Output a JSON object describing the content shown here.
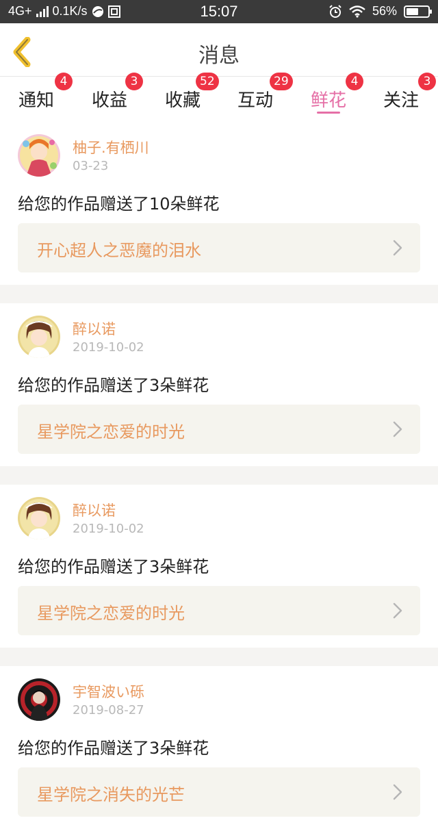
{
  "status_bar": {
    "network": "4G+",
    "speed": "0.1K/s",
    "time": "15:07",
    "battery_percent": "56%",
    "battery_level": 0.56,
    "icons": [
      "signal-icon",
      "browser-icon",
      "app-icon",
      "alarm-icon",
      "wifi-icon",
      "battery-icon"
    ]
  },
  "header": {
    "back_icon": "chevron-left-icon",
    "title": "消息"
  },
  "tabs": [
    {
      "label": "通知",
      "badge": "4",
      "active": false
    },
    {
      "label": "收益",
      "badge": "3",
      "active": false
    },
    {
      "label": "收藏",
      "badge": "52",
      "active": false
    },
    {
      "label": "互动",
      "badge": "29",
      "active": false
    },
    {
      "label": "鲜花",
      "badge": "4",
      "active": true
    },
    {
      "label": "关注",
      "badge": "3",
      "active": false
    }
  ],
  "colors": {
    "accent": "#e56fa6",
    "name_orange": "#e8995f",
    "badge_red": "#ee3344",
    "back_yellow": "#f0c02e",
    "link_bg": "#f5f4ee",
    "separator": "#f5f4f2",
    "status_bar_bg": "#3a3a3a"
  },
  "messages": [
    {
      "user": "柚子.有栖川",
      "date": "03-23",
      "action": "给您的作品赠送了10朵鲜花",
      "work": "开心超人之恶魔的泪水"
    },
    {
      "user": "醉以诺",
      "date": "2019-10-02",
      "action": "给您的作品赠送了3朵鲜花",
      "work": "星学院之恋爱的时光"
    },
    {
      "user": "醉以诺",
      "date": "2019-10-02",
      "action": "给您的作品赠送了3朵鲜花",
      "work": "星学院之恋爱的时光"
    },
    {
      "user": "宇智波い砾",
      "date": "2019-08-27",
      "action": "给您的作品赠送了3朵鲜花",
      "work": "星学院之消失的光芒"
    }
  ]
}
